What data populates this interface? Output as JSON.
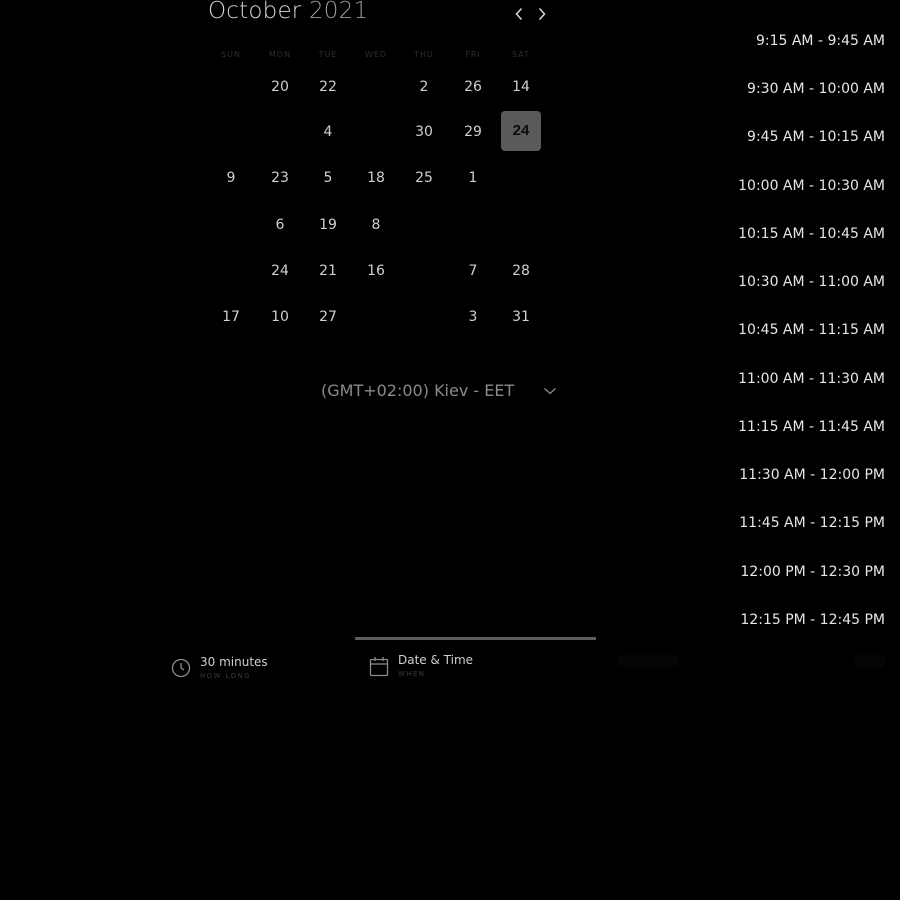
{
  "calendar": {
    "month": "October",
    "year": "2021",
    "weekdays": [
      "SUN",
      "MON",
      "TUE",
      "WED",
      "THU",
      "FRI",
      "SAT"
    ],
    "rows": [
      [
        "",
        "20",
        "22",
        "",
        "2",
        "26",
        "14"
      ],
      [
        "",
        "",
        "4",
        "",
        "30",
        "29",
        "24"
      ],
      [
        "9",
        "23",
        "5",
        "18",
        "25",
        "1",
        ""
      ],
      [
        "",
        "6",
        "19",
        "8",
        "",
        "",
        ""
      ],
      [
        "",
        "24",
        "21",
        "16",
        "",
        "7",
        "28"
      ],
      [
        "17",
        "10",
        "27",
        "",
        "",
        "3",
        "31"
      ]
    ],
    "selected_day": "24"
  },
  "timezone": {
    "value": "(GMT+02:00) Kiev - EET"
  },
  "time_slots": [
    "9:15 AM - 9:45 AM",
    "9:30 AM - 10:00 AM",
    "9:45 AM - 10:15 AM",
    "10:00 AM - 10:30 AM",
    "10:15 AM - 10:45 AM",
    "10:30 AM - 11:00 AM",
    "10:45 AM - 11:15 AM",
    "11:00 AM - 11:30 AM",
    "11:15 AM - 11:45 AM",
    "11:30 AM - 12:00 PM",
    "11:45 AM - 12:15 PM",
    "12:00 PM - 12:30 PM",
    "12:15 PM - 12:45 PM"
  ],
  "steps": {
    "duration": {
      "label": "30 minutes",
      "sub": "HOW LONG"
    },
    "datetime": {
      "label": "Date & Time",
      "sub": "WHEN"
    }
  },
  "icons": {
    "prev": "chevron-left-icon",
    "next": "chevron-right-icon",
    "tz_toggle": "chevron-down-icon",
    "duration": "clock-icon",
    "datetime": "calendar-icon"
  },
  "colors": {
    "background": "#000000",
    "text": "#d7d7d7",
    "selected_bg": "#5a5a5a",
    "active_step_bar": "#5e5e5e"
  }
}
